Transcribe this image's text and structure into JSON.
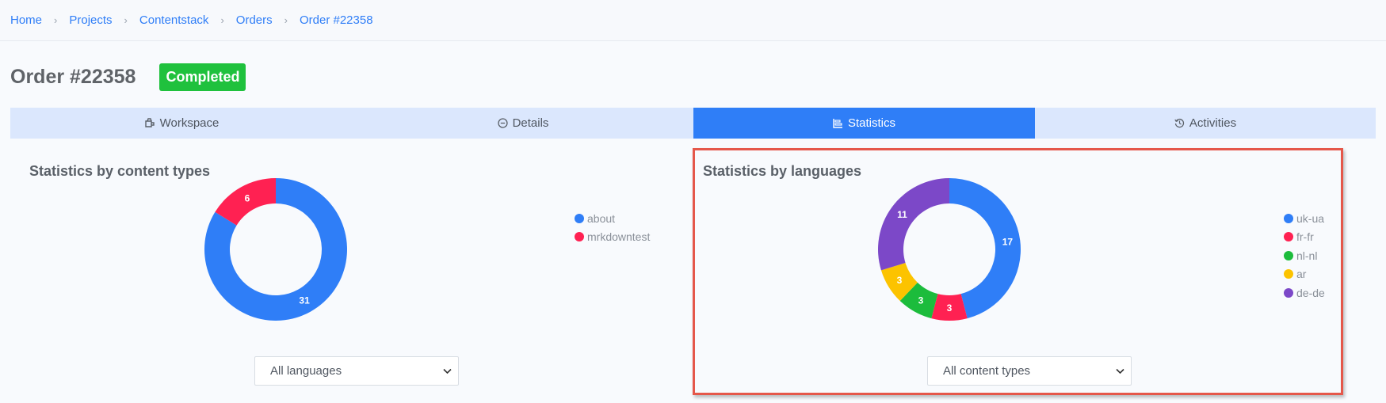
{
  "breadcrumb": [
    "Home",
    "Projects",
    "Contentstack",
    "Orders",
    "Order #22358"
  ],
  "page": {
    "title": "Order #22358",
    "status": "Completed"
  },
  "tabs": [
    {
      "label": "Workspace",
      "icon": "box-icon",
      "active": false
    },
    {
      "label": "Details",
      "icon": "minus-circle-icon",
      "active": false
    },
    {
      "label": "Statistics",
      "icon": "chart-icon",
      "active": true
    },
    {
      "label": "Activities",
      "icon": "history-icon",
      "active": false
    }
  ],
  "content_types_panel": {
    "title": "Statistics by content types",
    "filter": "All languages",
    "chart_data": {
      "type": "pie",
      "categories": [
        "about",
        "mrkdowntest"
      ],
      "values": [
        31,
        6
      ],
      "colors": [
        "#2f7ef7",
        "#ff2152"
      ]
    }
  },
  "languages_panel": {
    "title": "Statistics by languages",
    "filter": "All content types",
    "chart_data": {
      "type": "pie",
      "categories": [
        "uk-ua",
        "fr-fr",
        "nl-nl",
        "ar",
        "de-de"
      ],
      "values": [
        17,
        3,
        3,
        3,
        11
      ],
      "colors": [
        "#2f7ef7",
        "#ff2152",
        "#1cbc3c",
        "#fcc300",
        "#7c48c8"
      ]
    }
  }
}
